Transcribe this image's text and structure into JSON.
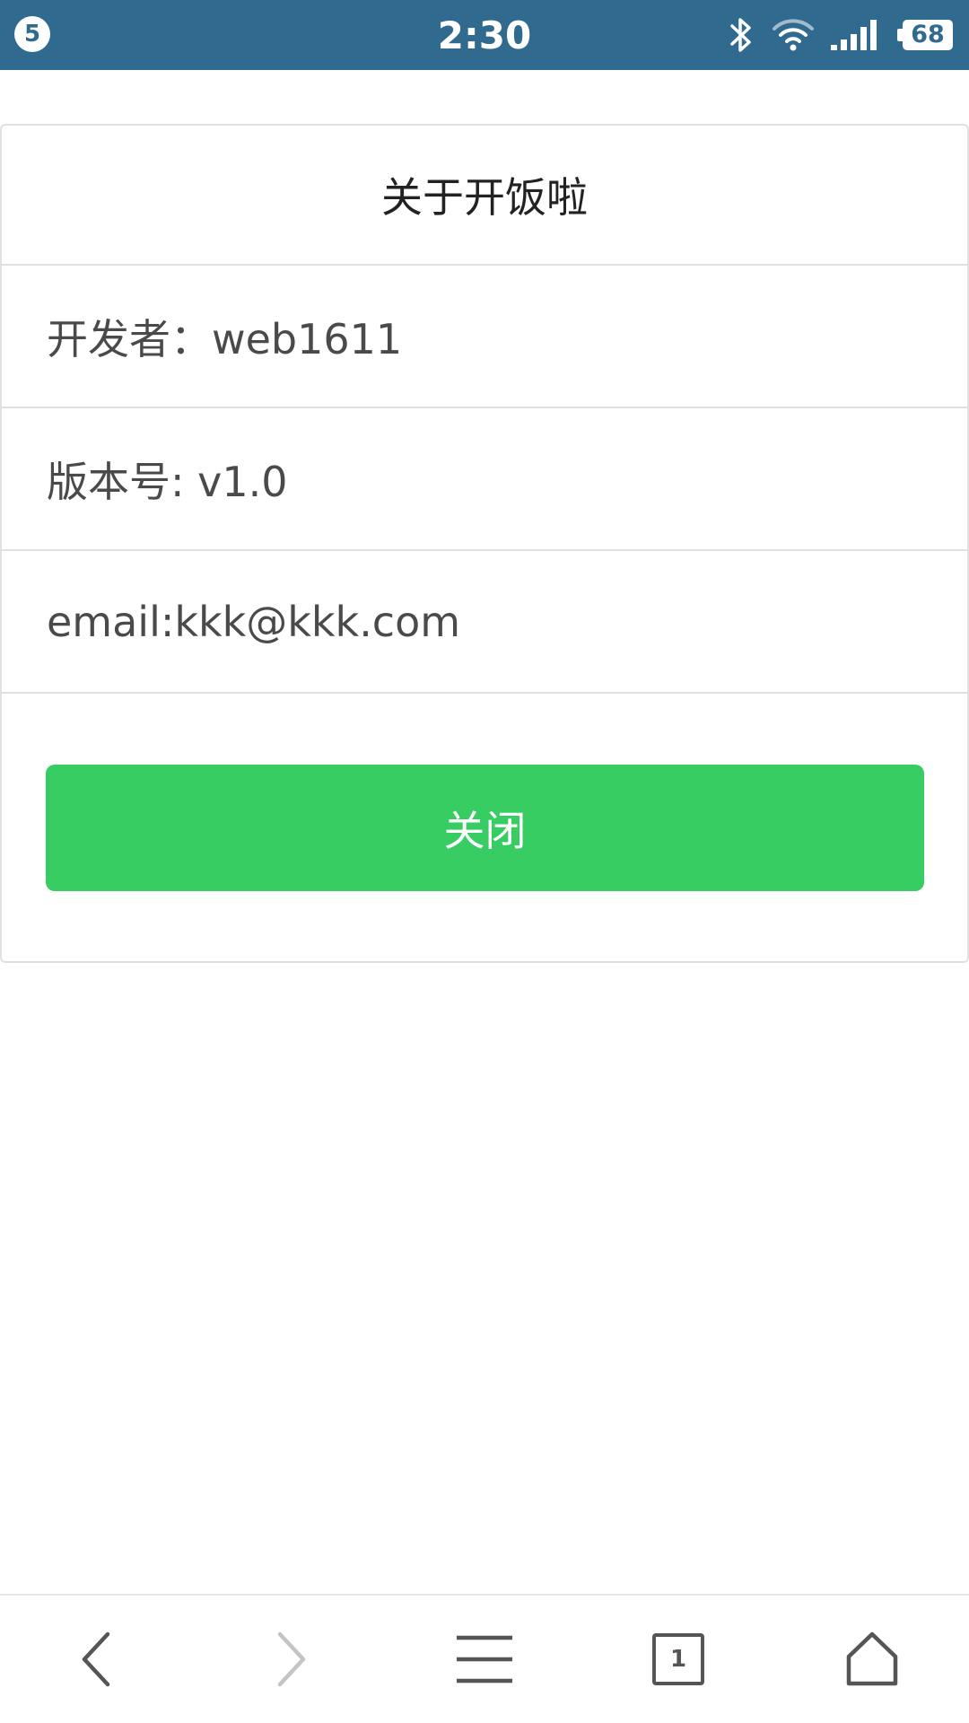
{
  "status_bar": {
    "notification_count": "5",
    "time": "2:30",
    "battery_level": "68",
    "icons": [
      "bluetooth-icon",
      "wifi-icon",
      "signal-icon",
      "battery-icon"
    ],
    "background_color": "#316a8f"
  },
  "about_dialog": {
    "title": "关于开饭啦",
    "developer": "开发者：web1611",
    "version": "版本号: v1.0",
    "email": "email:kkk@kkk.com",
    "close_label": "关闭",
    "close_button_color": "#37cd62"
  },
  "browser_toolbar": {
    "tab_count": "1",
    "buttons": [
      "back-icon",
      "forward-icon",
      "menu-icon",
      "tabs-icon",
      "home-icon"
    ]
  }
}
